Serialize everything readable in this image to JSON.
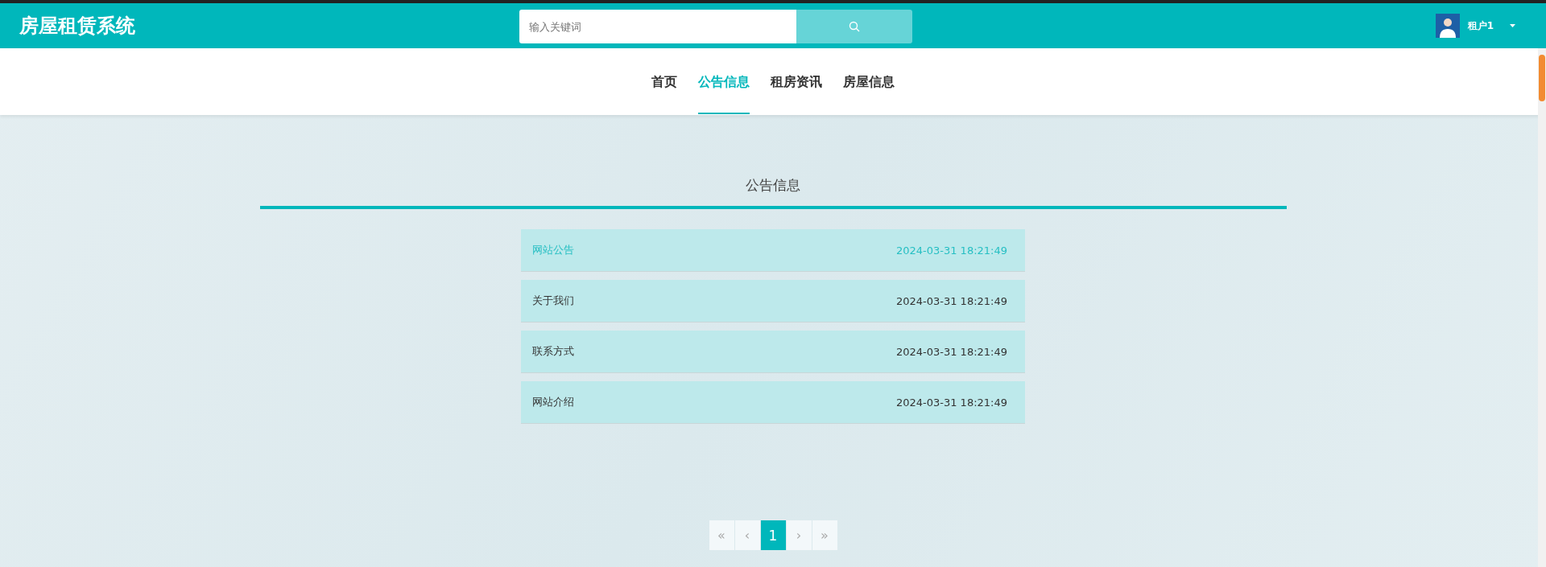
{
  "header": {
    "site_title": "房屋租赁系统",
    "search": {
      "placeholder": "输入关键词"
    },
    "user": {
      "name": "租户1"
    }
  },
  "nav": [
    {
      "label": "首页",
      "selected": false
    },
    {
      "label": "公告信息",
      "selected": true
    },
    {
      "label": "租房资讯",
      "selected": false
    },
    {
      "label": "房屋信息",
      "selected": false
    }
  ],
  "section_title": "公告信息",
  "notices": [
    {
      "title": "网站公告",
      "time": "2024-03-31 18:21:49",
      "highlighted": true
    },
    {
      "title": "关于我们",
      "time": "2024-03-31 18:21:49",
      "highlighted": false
    },
    {
      "title": "联系方式",
      "time": "2024-03-31 18:21:49",
      "highlighted": false
    },
    {
      "title": "网站介绍",
      "time": "2024-03-31 18:21:49",
      "highlighted": false
    }
  ],
  "pagination": [
    {
      "label": "«",
      "selected": false
    },
    {
      "label": "‹",
      "selected": false
    },
    {
      "label": "1",
      "selected": true
    },
    {
      "label": "›",
      "selected": false
    },
    {
      "label": "»",
      "selected": false
    }
  ]
}
